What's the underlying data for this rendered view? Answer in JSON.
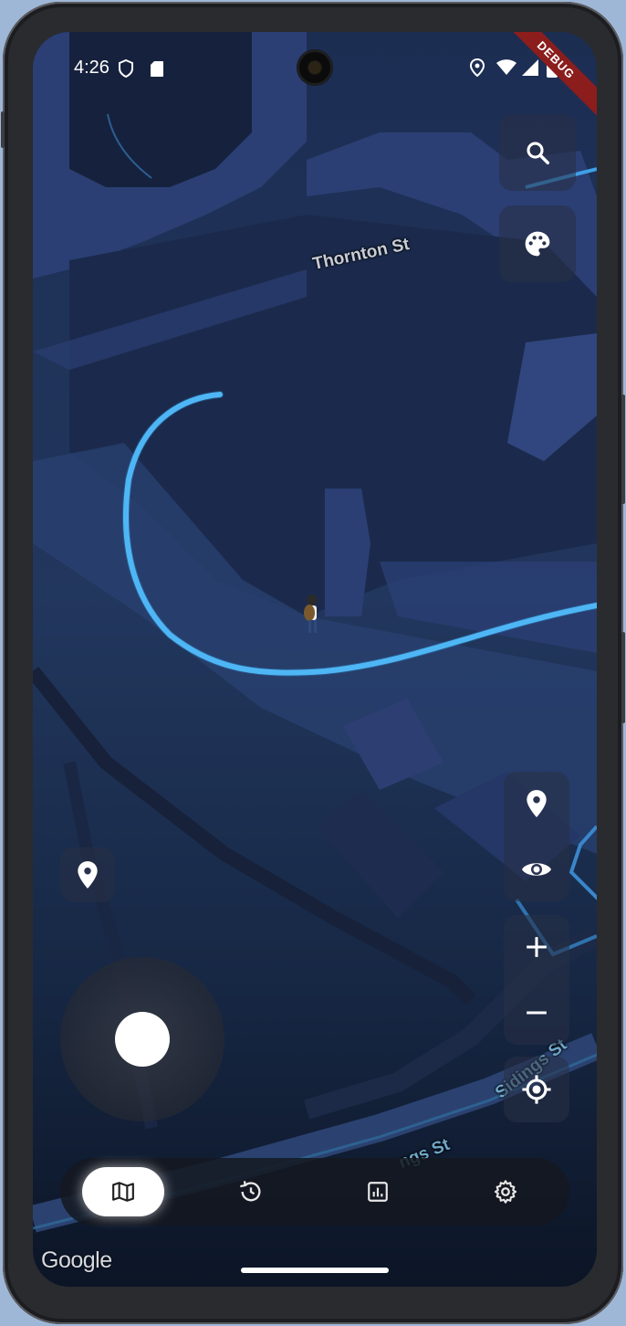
{
  "status_bar": {
    "time": "4:26",
    "debug_banner": "DEBUG"
  },
  "map": {
    "street_labels": [
      "Thornton St",
      "Sidings St",
      "ngs St"
    ],
    "attribution": "Google"
  },
  "colors": {
    "route": "#4fb6f5",
    "map_dark": "#1a2b4b",
    "map_block": "#2b3f74",
    "active_tab": "#ffffff"
  },
  "top_buttons": [
    {
      "name": "search",
      "icon": "search-icon"
    },
    {
      "name": "theme",
      "icon": "palette-icon"
    }
  ],
  "right_controls": [
    {
      "name": "pin",
      "icon": "location-pin-icon"
    },
    {
      "name": "visibility",
      "icon": "eye-icon"
    },
    {
      "name": "zoom-in",
      "icon": "plus-icon"
    },
    {
      "name": "zoom-out",
      "icon": "minus-icon"
    },
    {
      "name": "my-location",
      "icon": "crosshair-icon"
    }
  ],
  "nav": {
    "items": [
      {
        "name": "map",
        "icon": "map-icon",
        "active": true
      },
      {
        "name": "history",
        "icon": "history-icon",
        "active": false
      },
      {
        "name": "stats",
        "icon": "chart-icon",
        "active": false
      },
      {
        "name": "settings",
        "icon": "gear-icon",
        "active": false
      }
    ]
  }
}
